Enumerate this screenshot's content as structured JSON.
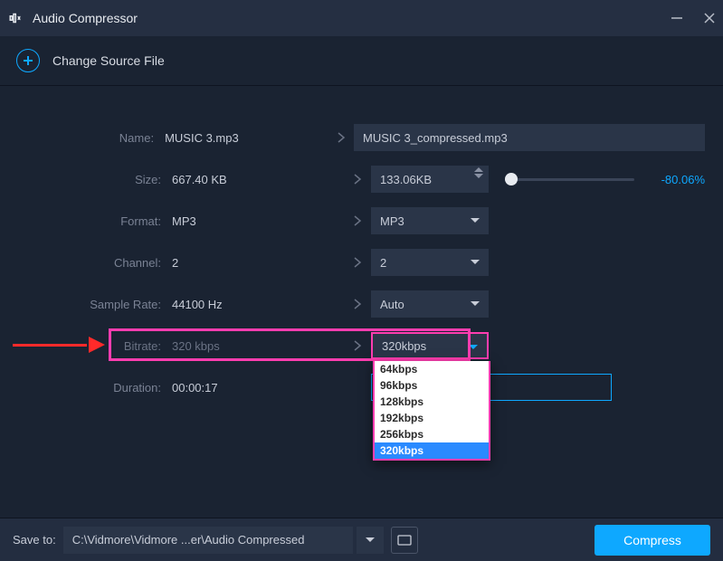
{
  "window": {
    "title": "Audio Compressor"
  },
  "source": {
    "change_label": "Change Source File"
  },
  "labels": {
    "name": "Name:",
    "size": "Size:",
    "format": "Format:",
    "channel": "Channel:",
    "sample_rate": "Sample Rate:",
    "bitrate": "Bitrate:",
    "duration": "Duration:"
  },
  "values": {
    "name_in": "MUSIC 3.mp3",
    "name_out": "MUSIC 3_compressed.mp3",
    "size_in": "667.40 KB",
    "size_out": "133.06KB",
    "size_pct": "-80.06%",
    "format_in": "MP3",
    "format_out": "MP3",
    "channel_in": "2",
    "channel_out": "2",
    "sample_rate_in": "44100 Hz",
    "sample_rate_out": "Auto",
    "bitrate_in": "320 kbps",
    "bitrate_out": "320kbps",
    "duration": "00:00:17"
  },
  "bitrate_options": [
    "64kbps",
    "96kbps",
    "128kbps",
    "192kbps",
    "256kbps",
    "320kbps"
  ],
  "bitrate_selected": "320kbps",
  "footer": {
    "saveto_label": "Save to:",
    "path": "C:\\Vidmore\\Vidmore ...er\\Audio Compressed",
    "compress_label": "Compress"
  }
}
